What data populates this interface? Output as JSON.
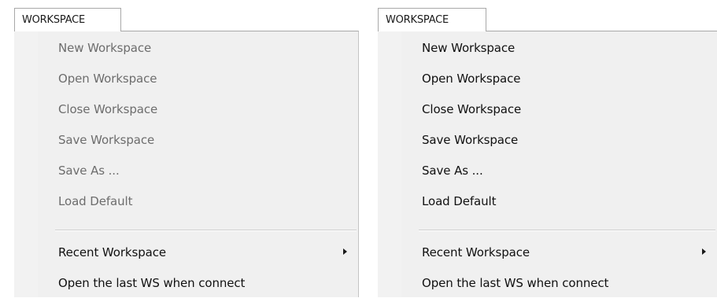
{
  "panels": [
    {
      "tab_label": "WORKSPACE",
      "state": "disabled",
      "items": [
        {
          "label": "New Workspace"
        },
        {
          "label": "Open Workspace"
        },
        {
          "label": "Close Workspace"
        },
        {
          "label": "Save Workspace"
        },
        {
          "label": "Save As ..."
        },
        {
          "label": "Load Default"
        }
      ],
      "recent_label": "Recent Workspace",
      "open_last_label": "Open the last WS when connect"
    },
    {
      "tab_label": "WORKSPACE",
      "state": "enabled",
      "items": [
        {
          "label": "New Workspace"
        },
        {
          "label": "Open Workspace"
        },
        {
          "label": "Close Workspace"
        },
        {
          "label": "Save Workspace"
        },
        {
          "label": "Save As ..."
        },
        {
          "label": "Load Default"
        }
      ],
      "recent_label": "Recent Workspace",
      "open_last_label": "Open the last WS when connect"
    }
  ],
  "icons": {
    "submenu": "chevron-right-icon"
  }
}
